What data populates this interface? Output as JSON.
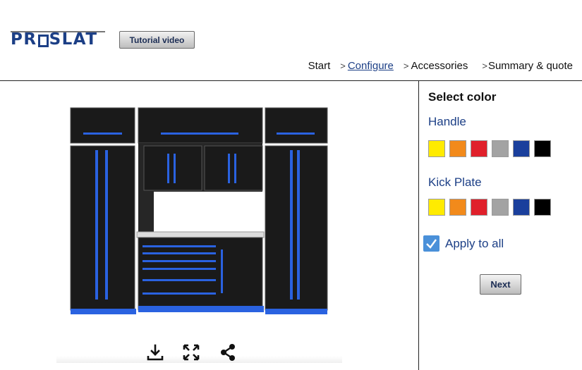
{
  "header": {
    "logo_left": "PR",
    "logo_right": "SLAT",
    "tutorial_label": "Tutorial video"
  },
  "breadcrumb": {
    "steps": [
      "Start",
      "Configure",
      "Accessories",
      "Summary & quote"
    ],
    "active_index": 1,
    "separator": ">"
  },
  "preview": {
    "product": "black cabinet set with blue handles and blue kick plate",
    "toolbar_icons": [
      "download-icon",
      "fullscreen-icon",
      "share-icon"
    ]
  },
  "panel": {
    "title": "Select color",
    "handle": {
      "label": "Handle",
      "colors": [
        "#ffeb00",
        "#f28a1b",
        "#e0202b",
        "#a3a3a3",
        "#1a3f9c",
        "#000000"
      ]
    },
    "kick_plate": {
      "label": "Kick Plate",
      "colors": [
        "#ffeb00",
        "#f28a1b",
        "#e0202b",
        "#a3a3a3",
        "#1a3f9c",
        "#000000"
      ]
    },
    "apply_all": {
      "label": "Apply to all",
      "checked": true
    },
    "next_label": "Next"
  },
  "colors": {
    "brand": "#1c3f86",
    "cabinet_body": "#1a1a1a",
    "handle_blue": "#2a62e0",
    "checkbox": "#4a90d9"
  }
}
